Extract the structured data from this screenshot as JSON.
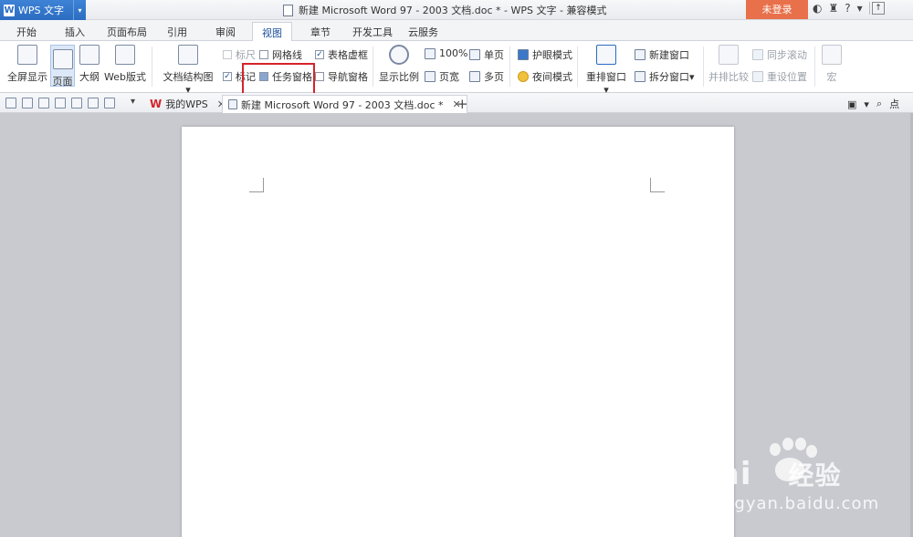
{
  "titlebar": {
    "app_name": "WPS 文字",
    "title": "新建 Microsoft Word 97 - 2003 文档.doc * - WPS 文字 - 兼容模式",
    "login": "未登录"
  },
  "menu_tabs": [
    "开始",
    "插入",
    "页面布局",
    "引用",
    "审阅",
    "视图",
    "章节",
    "开发工具",
    "云服务"
  ],
  "ribbon": {
    "fullscreen": "全屏显示",
    "page": "页面",
    "outline": "大纲",
    "web": "Web版式",
    "doc_map": "文档结构图",
    "ruler": "标尺",
    "gridlines": "网格线",
    "table_gridlines": "表格虚框",
    "marks": "标记",
    "task_pane": "任务窗格",
    "nav_pane": "导航窗格",
    "zoom": "显示比例",
    "zoom_100": "100%",
    "page_width": "页宽",
    "single_page": "单页",
    "multi_page": "多页",
    "eye_mode": "护眼模式",
    "night_mode": "夜间模式",
    "arrange": "重排窗口",
    "new_window": "新建窗口",
    "split_window": "拆分窗口",
    "side_by_side": "并排比较",
    "sync_scroll": "同步滚动",
    "reset_position": "重设位置",
    "macro": "宏"
  },
  "doc_tabs": {
    "home": "我的WPS",
    "current": "新建 Microsoft Word 97 - 2003 文档.doc *",
    "right_tool": "点"
  },
  "watermark": {
    "brand": "Bai",
    "brand_cn": "经验",
    "url": "jingyan.baidu.com"
  }
}
